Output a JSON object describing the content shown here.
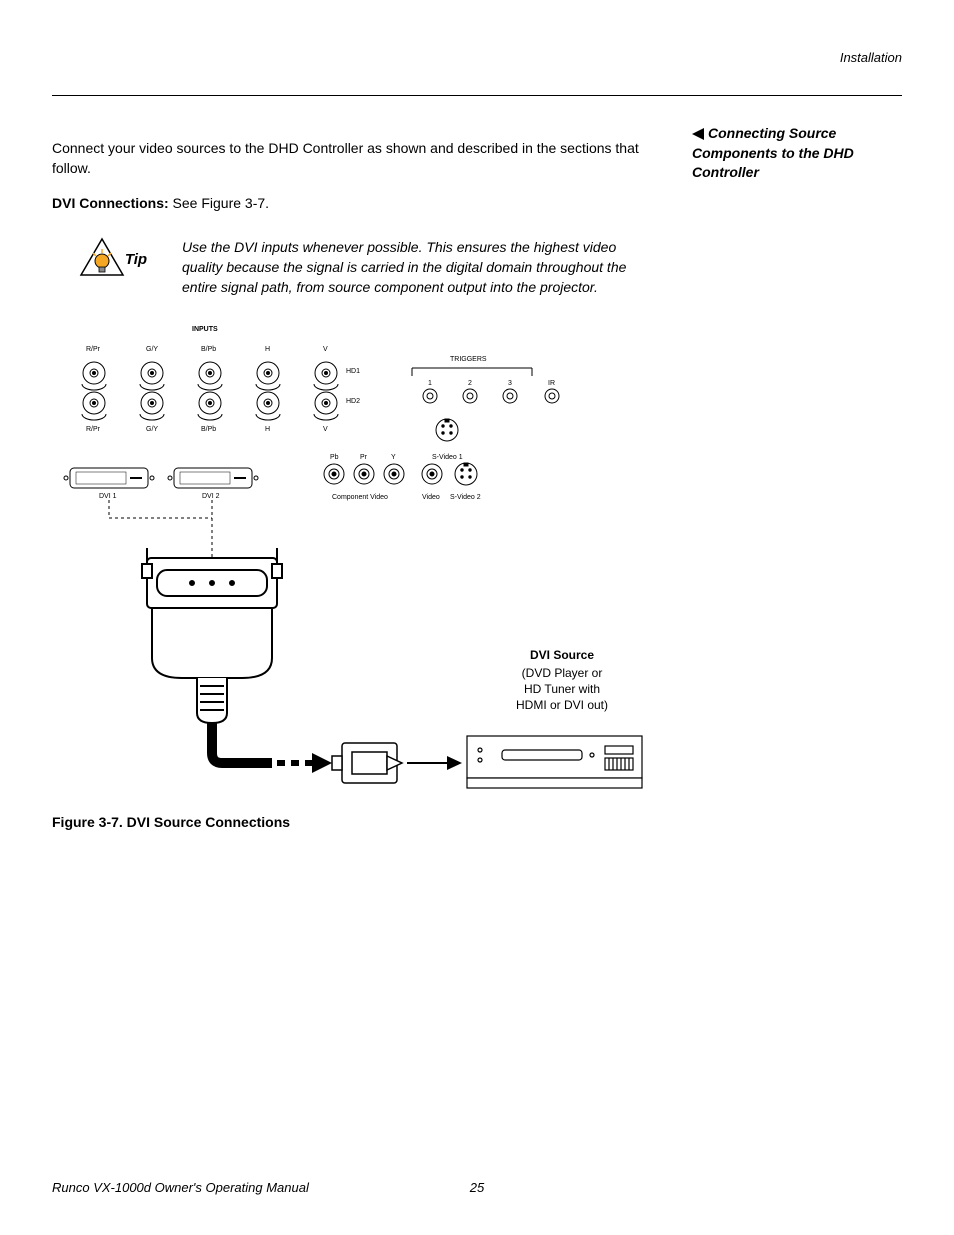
{
  "header": {
    "section": "Installation"
  },
  "body": {
    "intro": "Connect your video sources to the DHD Controller as shown and described in the sections that follow.",
    "dvi_heading": "DVI Connections:",
    "dvi_ref": " See Figure 3-7."
  },
  "sidebar": {
    "heading": "Connecting Source Components to the DHD Controller"
  },
  "tip": {
    "label": "Tip",
    "text": "Use the DVI inputs whenever possible. This ensures the highest video quality because the signal is carried in the digital domain throughout the entire signal path, from source component output into the projector."
  },
  "diagram": {
    "inputs_label": "INPUTS",
    "top_labels": [
      "R/Pr",
      "G/Y",
      "B/Pb",
      "H",
      "V"
    ],
    "hd_labels": [
      "HD1",
      "HD2"
    ],
    "triggers_label": "TRIGGERS",
    "trigger_nums": [
      "1",
      "2",
      "3"
    ],
    "ir_label": "IR",
    "dvi_labels": [
      "DVI 1",
      "DVI 2"
    ],
    "comp_labels": [
      "Pb",
      "Pr",
      "Y"
    ],
    "svideo1": "S-Video 1",
    "component_video": "Component Video",
    "video_label": "Video",
    "svideo2": "S-Video 2",
    "source_title": "DVI Source",
    "source_line1": "(DVD Player or",
    "source_line2": "HD Tuner with",
    "source_line3": "HDMI or DVI out)"
  },
  "caption": "Figure 3-7. DVI Source Connections",
  "footer": {
    "manual": "Runco VX-1000d Owner's Operating Manual",
    "page": "25"
  }
}
